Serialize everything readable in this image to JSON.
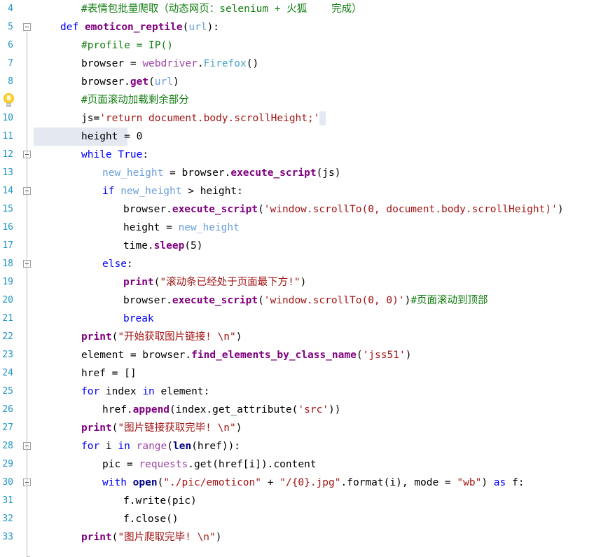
{
  "editor": {
    "app": "python-code-editor",
    "language": "Python",
    "font_size": "14.5px",
    "line_height": 26,
    "selected_line_number": "10",
    "gutter": {
      "lineno_color": "#2196c4",
      "fold_marker_label": "collapse",
      "intention_icon": "lightbulb-icon",
      "intention_line_number": "9"
    },
    "colors": {
      "background": "#ffffff",
      "keyword": "#0000ff",
      "function": "#800080",
      "string": "#a31515",
      "comment": "#107c10",
      "class": "#4aa3c7",
      "local_var": "#6a9fd8",
      "selection": "#e4e8f1",
      "line_number": "#2196c4",
      "guide_line": "#d4d4d4"
    }
  },
  "lines": [
    {
      "n": "4",
      "indent": 1,
      "tokens": [
        {
          "t": "com",
          "v": "#表情包批量爬取（动态网页：selenium + 火狐    完成）"
        }
      ]
    },
    {
      "n": "5",
      "indent": 0,
      "fold": true,
      "tokens": [
        {
          "t": "kw",
          "v": "def"
        },
        {
          "t": "plain",
          "v": " "
        },
        {
          "t": "fnname",
          "v": "emoticon_reptile"
        },
        {
          "t": "plain",
          "v": "("
        },
        {
          "t": "param",
          "v": "url"
        },
        {
          "t": "plain",
          "v": "):"
        }
      ]
    },
    {
      "n": "6",
      "indent": 1,
      "tokens": [
        {
          "t": "com",
          "v": "#profile = IP()"
        }
      ]
    },
    {
      "n": "7",
      "indent": 1,
      "tokens": [
        {
          "t": "plain",
          "v": "browser = "
        },
        {
          "t": "mod",
          "v": "webdriver"
        },
        {
          "t": "plain",
          "v": "."
        },
        {
          "t": "cls",
          "v": "Firefox"
        },
        {
          "t": "plain",
          "v": "()"
        }
      ]
    },
    {
      "n": "8",
      "indent": 1,
      "tokens": [
        {
          "t": "plain",
          "v": "browser."
        },
        {
          "t": "fn",
          "v": "get"
        },
        {
          "t": "plain",
          "v": "("
        },
        {
          "t": "param",
          "v": "url"
        },
        {
          "t": "plain",
          "v": ")"
        }
      ]
    },
    {
      "n": "9",
      "indent": 1,
      "tokens": [
        {
          "t": "com",
          "v": "#页面滚动加载剩余部分"
        }
      ]
    },
    {
      "n": "10",
      "indent": 1,
      "caret": true,
      "tokens": [
        {
          "t": "plain",
          "v": "js="
        },
        {
          "t": "str",
          "v": "'return document.body.scrollHeight;'"
        }
      ]
    },
    {
      "n": "11",
      "indent": 1,
      "selected": true,
      "tokens": [
        {
          "t": "plain",
          "v": "height = "
        },
        {
          "t": "num",
          "v": "0"
        }
      ]
    },
    {
      "n": "12",
      "indent": 1,
      "fold": true,
      "tokens": [
        {
          "t": "kw",
          "v": "while"
        },
        {
          "t": "plain",
          "v": " "
        },
        {
          "t": "kw",
          "v": "True"
        },
        {
          "t": "plain",
          "v": ":"
        }
      ]
    },
    {
      "n": "13",
      "indent": 2,
      "tokens": [
        {
          "t": "param",
          "v": "new_height"
        },
        {
          "t": "plain",
          "v": " = browser."
        },
        {
          "t": "fn",
          "v": "execute_script"
        },
        {
          "t": "plain",
          "v": "(js)"
        }
      ]
    },
    {
      "n": "14",
      "indent": 2,
      "fold": true,
      "tokens": [
        {
          "t": "kw",
          "v": "if"
        },
        {
          "t": "plain",
          "v": " "
        },
        {
          "t": "param",
          "v": "new_height"
        },
        {
          "t": "plain",
          "v": " > height:"
        }
      ]
    },
    {
      "n": "15",
      "indent": 3,
      "tokens": [
        {
          "t": "plain",
          "v": "browser."
        },
        {
          "t": "fn",
          "v": "execute_script"
        },
        {
          "t": "plain",
          "v": "("
        },
        {
          "t": "str",
          "v": "'window.scrollTo(0, document.body.scrollHeight)'"
        },
        {
          "t": "plain",
          "v": ")"
        }
      ]
    },
    {
      "n": "16",
      "indent": 3,
      "tokens": [
        {
          "t": "plain",
          "v": "height = "
        },
        {
          "t": "param",
          "v": "new_height"
        }
      ]
    },
    {
      "n": "17",
      "indent": 3,
      "tokens": [
        {
          "t": "plain",
          "v": "time."
        },
        {
          "t": "fn",
          "v": "sleep"
        },
        {
          "t": "plain",
          "v": "("
        },
        {
          "t": "num",
          "v": "5"
        },
        {
          "t": "plain",
          "v": ")"
        }
      ]
    },
    {
      "n": "18",
      "indent": 2,
      "fold": true,
      "tokens": [
        {
          "t": "kw",
          "v": "else"
        },
        {
          "t": "plain",
          "v": ":"
        }
      ]
    },
    {
      "n": "19",
      "indent": 3,
      "tokens": [
        {
          "t": "fn",
          "v": "print"
        },
        {
          "t": "plain",
          "v": "("
        },
        {
          "t": "str",
          "v": "\"滚动条已经处于页面最下方!\""
        },
        {
          "t": "plain",
          "v": ")"
        }
      ]
    },
    {
      "n": "20",
      "indent": 3,
      "tokens": [
        {
          "t": "plain",
          "v": "browser."
        },
        {
          "t": "fn",
          "v": "execute_script"
        },
        {
          "t": "plain",
          "v": "("
        },
        {
          "t": "str",
          "v": "'window.scrollTo(0, 0)'"
        },
        {
          "t": "plain",
          "v": ")"
        },
        {
          "t": "com",
          "v": "#页面滚动到顶部"
        }
      ]
    },
    {
      "n": "21",
      "indent": 3,
      "tokens": [
        {
          "t": "kw",
          "v": "break"
        }
      ]
    },
    {
      "n": "22",
      "indent": 1,
      "tokens": [
        {
          "t": "fn",
          "v": "print"
        },
        {
          "t": "plain",
          "v": "("
        },
        {
          "t": "str",
          "v": "\"开始获取图片链接! \\n\""
        },
        {
          "t": "plain",
          "v": ")"
        }
      ]
    },
    {
      "n": "23",
      "indent": 1,
      "tokens": [
        {
          "t": "plain",
          "v": "element = browser."
        },
        {
          "t": "fn",
          "v": "find_elements_by_class_name"
        },
        {
          "t": "plain",
          "v": "("
        },
        {
          "t": "str",
          "v": "'jss51'"
        },
        {
          "t": "plain",
          "v": ")"
        }
      ]
    },
    {
      "n": "24",
      "indent": 1,
      "tokens": [
        {
          "t": "plain",
          "v": "href = []"
        }
      ]
    },
    {
      "n": "25",
      "indent": 1,
      "tokens": [
        {
          "t": "kw",
          "v": "for"
        },
        {
          "t": "plain",
          "v": " index "
        },
        {
          "t": "kw",
          "v": "in"
        },
        {
          "t": "plain",
          "v": " element:"
        }
      ]
    },
    {
      "n": "26",
      "indent": 2,
      "tokens": [
        {
          "t": "plain",
          "v": "href."
        },
        {
          "t": "fn",
          "v": "append"
        },
        {
          "t": "plain",
          "v": "(index.get_attribute("
        },
        {
          "t": "str",
          "v": "'src'"
        },
        {
          "t": "plain",
          "v": "))"
        }
      ]
    },
    {
      "n": "27",
      "indent": 1,
      "tokens": [
        {
          "t": "fn",
          "v": "print"
        },
        {
          "t": "plain",
          "v": "("
        },
        {
          "t": "str",
          "v": "\"图片链接获取完毕! \\n\""
        },
        {
          "t": "plain",
          "v": ")"
        }
      ]
    },
    {
      "n": "28",
      "indent": 1,
      "fold": true,
      "tokens": [
        {
          "t": "kw",
          "v": "for"
        },
        {
          "t": "plain",
          "v": " i "
        },
        {
          "t": "kw",
          "v": "in"
        },
        {
          "t": "plain",
          "v": " "
        },
        {
          "t": "mod",
          "v": "range"
        },
        {
          "t": "plain",
          "v": "("
        },
        {
          "t": "builtin",
          "v": "len"
        },
        {
          "t": "plain",
          "v": "(href)):"
        }
      ]
    },
    {
      "n": "29",
      "indent": 2,
      "tokens": [
        {
          "t": "plain",
          "v": "pic = "
        },
        {
          "t": "mod",
          "v": "requests"
        },
        {
          "t": "plain",
          "v": ".get(href[i]).content"
        }
      ]
    },
    {
      "n": "30",
      "indent": 2,
      "fold": true,
      "tokens": [
        {
          "t": "kw",
          "v": "with"
        },
        {
          "t": "plain",
          "v": " "
        },
        {
          "t": "builtin",
          "v": "open"
        },
        {
          "t": "plain",
          "v": "("
        },
        {
          "t": "str",
          "v": "\"./pic/emoticon\""
        },
        {
          "t": "plain",
          "v": " + "
        },
        {
          "t": "str",
          "v": "\"/{0}.jpg\""
        },
        {
          "t": "plain",
          "v": ".format(i), mode = "
        },
        {
          "t": "str",
          "v": "\"wb\""
        },
        {
          "t": "plain",
          "v": ") "
        },
        {
          "t": "kw",
          "v": "as"
        },
        {
          "t": "plain",
          "v": " f:"
        }
      ]
    },
    {
      "n": "31",
      "indent": 3,
      "tokens": [
        {
          "t": "plain",
          "v": "f.write(pic)"
        }
      ]
    },
    {
      "n": "32",
      "indent": 3,
      "tokens": [
        {
          "t": "plain",
          "v": "f.close()"
        }
      ]
    },
    {
      "n": "33",
      "indent": 1,
      "tokens": [
        {
          "t": "fn",
          "v": "print"
        },
        {
          "t": "plain",
          "v": "("
        },
        {
          "t": "str",
          "v": "\"图片爬取完毕! \\n\""
        },
        {
          "t": "plain",
          "v": ")"
        }
      ]
    }
  ]
}
